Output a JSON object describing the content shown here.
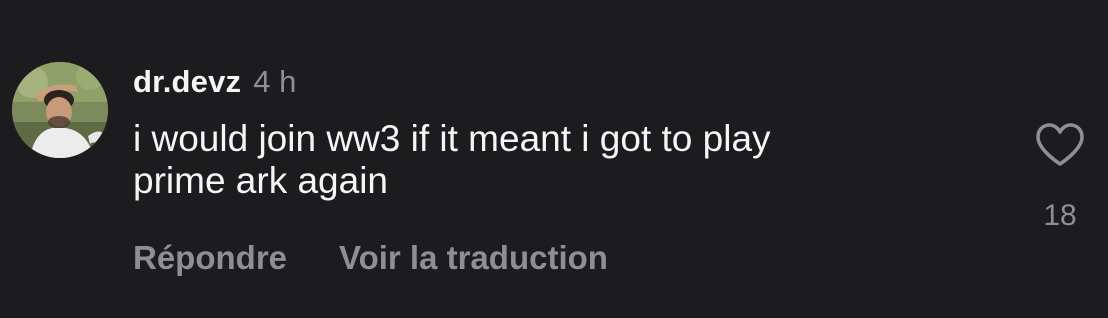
{
  "comment": {
    "username": "dr.devz",
    "time_ago": "4 h",
    "text": "i would join ww3 if it meant i got to play\nprime ark again",
    "like_count": "18",
    "actions": {
      "reply_label": "Répondre",
      "translate_label": "Voir la traduction"
    },
    "icons": {
      "like": "heart-outline-icon",
      "avatar": "user-avatar-photo"
    }
  },
  "colors": {
    "background": "#1c1c1e",
    "primary_text": "#f5f5f5",
    "secondary_text": "#8e8e93"
  }
}
